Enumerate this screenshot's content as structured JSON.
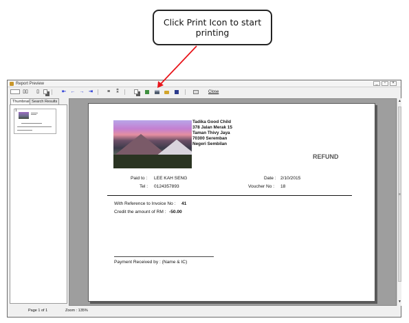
{
  "callout": {
    "line1": "Click Print Icon to start",
    "line2": "printing"
  },
  "window": {
    "title": "Report Preview",
    "toolbar": {
      "close_label": "Close"
    },
    "tabs": [
      "Thumbnails",
      "Search Results"
    ],
    "thumbnail_number": "1",
    "status": {
      "page": "Page 1 of 1",
      "zoom": "Zoom : 135%"
    }
  },
  "report": {
    "company": {
      "name": "Tadika Good Child",
      "address1": "378 Jalan Merak 15",
      "address2": "Taman Thivy Jaya",
      "address3": "70300 Seremban",
      "address4": "Negeri Sembilan"
    },
    "doc_type": "REFUND",
    "paid_to_label": "Paid to :",
    "paid_to": "LEE KAH SENG",
    "tel_label": "Tel :",
    "tel": "0124357893",
    "date_label": "Date :",
    "date": "2/10/2015",
    "voucher_label": "Voucher No :",
    "voucher": "18",
    "invoice_ref_label": "With Reference to Invoice No :",
    "invoice_no": "41",
    "credit_label": "Credit the amount of RM :",
    "credit_amount": "-50.00",
    "received_by": "Payment Received by : (Name & IC)"
  },
  "colors": {
    "arrow": "#e8141a",
    "toolbar_arrows": "#1a2ed6"
  }
}
